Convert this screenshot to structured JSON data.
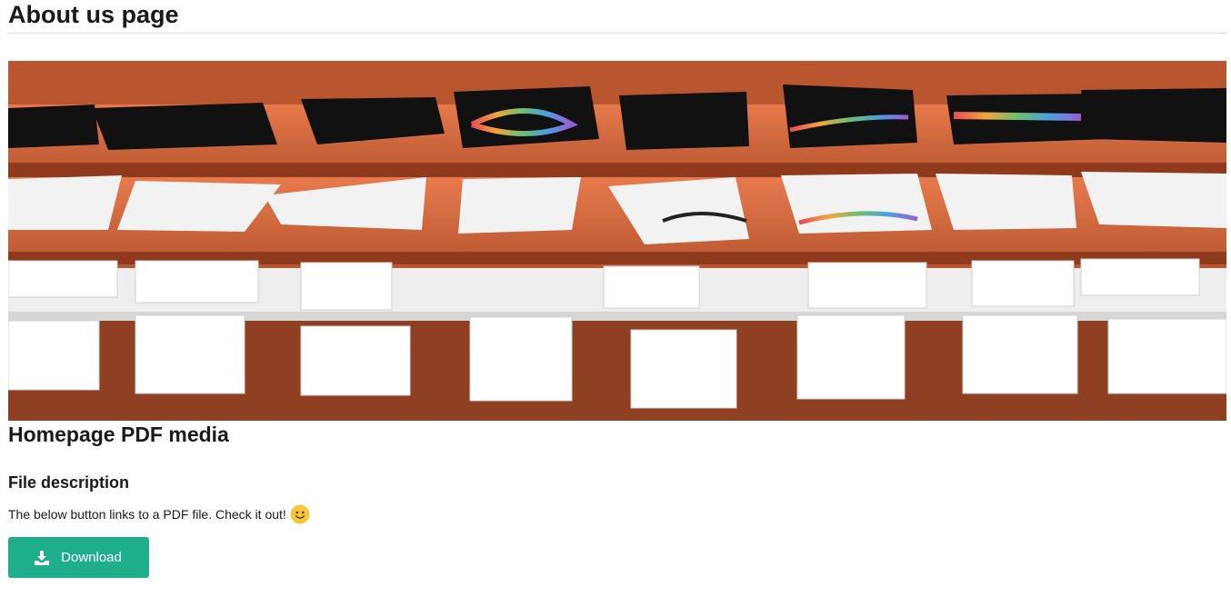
{
  "page": {
    "title": "About us page"
  },
  "hero_image": {
    "subject": "store shelves with folded t-shirts and boxed shirts"
  },
  "media": {
    "heading": "Homepage PDF media",
    "file_description_heading": "File description",
    "description_text": "The below button links to a PDF file. Check it out!",
    "emoji_icon": "slightly-smiling-face-icon"
  },
  "download": {
    "label": "Download",
    "icon": "download-icon"
  },
  "colors": {
    "accent": "#1fae8a",
    "text": "#1a1a1a",
    "rule": "#d9d9d9"
  }
}
